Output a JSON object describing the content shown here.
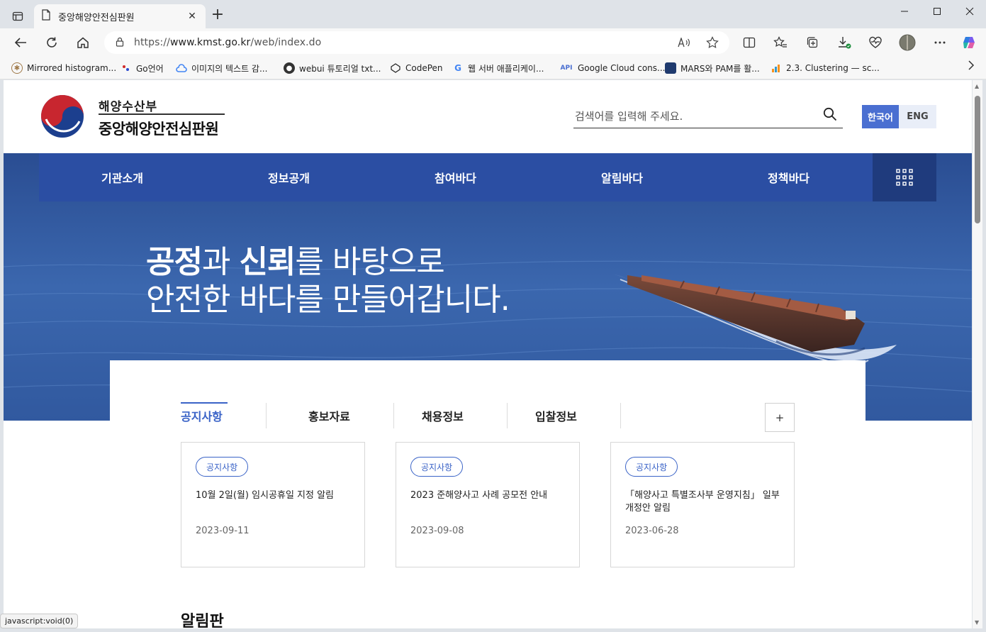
{
  "browser": {
    "tab_title": "중앙해양안전심판원",
    "url_prefix": "https://",
    "url_host": "www.kmst.go.kr",
    "url_path": "/web/index.do",
    "new_tab_glyph": "+",
    "close_glyph": "✕"
  },
  "bookmarks": [
    {
      "label": "Mirrored histogram...",
      "icon": "compass-icon"
    },
    {
      "label": "Go언어",
      "icon": "dots-icon"
    },
    {
      "label": "이미지의 텍스트 감...",
      "icon": "cloud-icon"
    },
    {
      "label": "webui 튜토리얼 txt...",
      "icon": "github-icon"
    },
    {
      "label": "CodePen",
      "icon": "codepen-icon"
    },
    {
      "label": "웹 서버 애플리케이...",
      "icon": "google-icon"
    },
    {
      "label": "Google Cloud cons...",
      "icon": "api-icon"
    },
    {
      "label": "MARS와 PAM를 활...",
      "icon": "chart-icon"
    },
    {
      "label": "2.3. Clustering — sc...",
      "icon": "sklearn-icon"
    }
  ],
  "site": {
    "ministry": "해양수산부",
    "org": "중앙해양안전심판원",
    "search_placeholder": "검색어를 입력해 주세요.",
    "lang_ko": "한국어",
    "lang_en": "ENG"
  },
  "gnb": [
    "기관소개",
    "정보공개",
    "참여바다",
    "알림바다",
    "정책바다"
  ],
  "hero": {
    "w1": "공정",
    "w2": "과 ",
    "w3": "신뢰",
    "w4": "를 바탕으로",
    "line2": "안전한 바다를 만들어갑니다."
  },
  "tabs": [
    "공지사항",
    "홍보자료",
    "채용정보",
    "입찰정보"
  ],
  "more_glyph": "+",
  "notices": [
    {
      "badge": "공지사항",
      "title": "10월 2일(월) 임시공휴일 지정 알림",
      "date": "2023-09-11"
    },
    {
      "badge": "공지사항",
      "title": "2023 준해양사고 사례 공모전 안내",
      "date": "2023-09-08"
    },
    {
      "badge": "공지사항",
      "title": "「해양사고 특별조사부 운영지침」 일부 개정안 알림",
      "date": "2023-06-28"
    }
  ],
  "board_title": "알림판",
  "status_text": "javascript:void(0)",
  "colors": {
    "primary": "#2b4ea3",
    "accent": "#3a63c7",
    "lang_active": "#4a6fd1"
  }
}
